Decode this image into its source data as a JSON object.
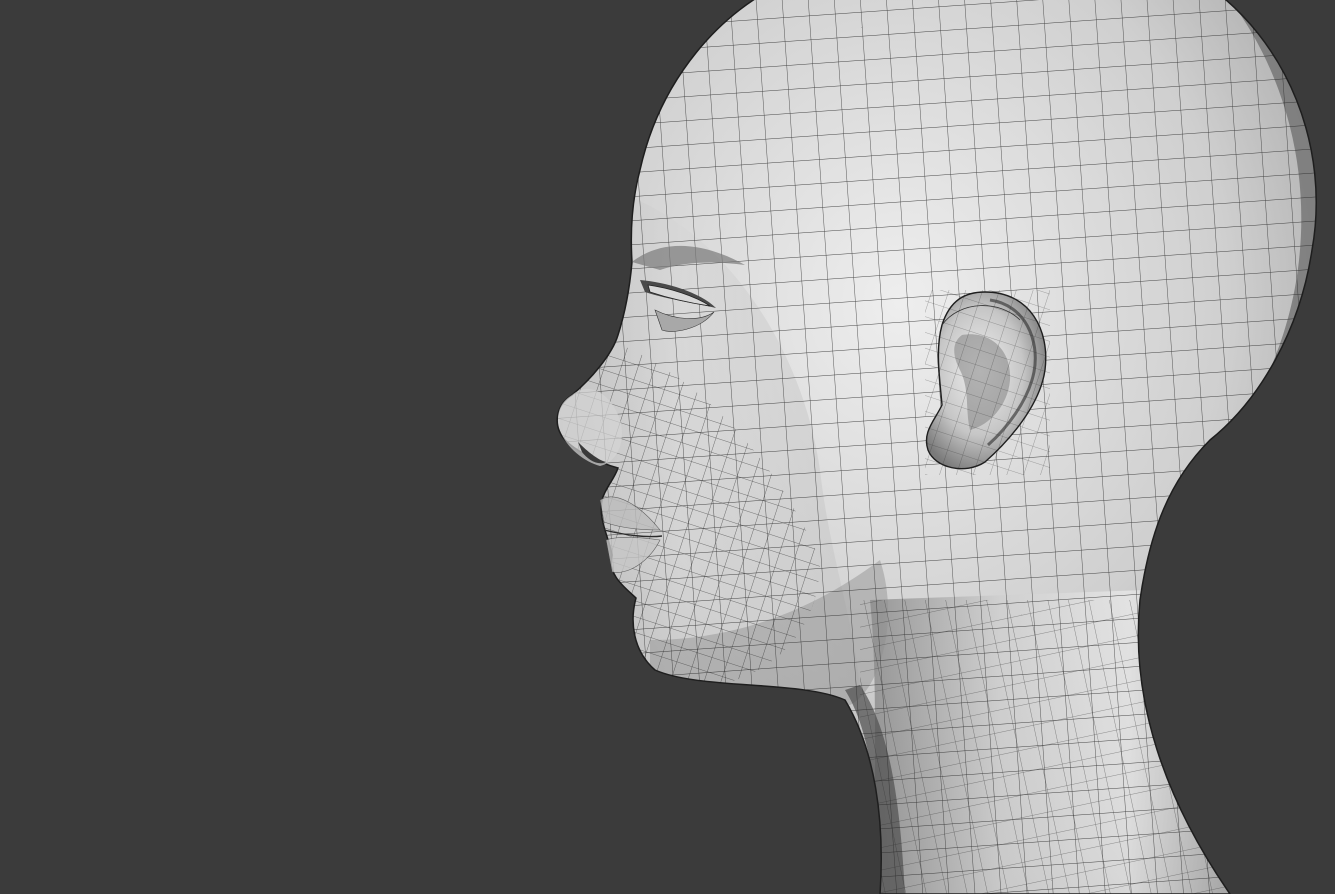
{
  "scene": {
    "subject": "head-mesh",
    "background_color": "#3b3b3b",
    "mesh_base_color": "#c9c9c9",
    "mesh_highlight_color": "#eeeeee",
    "mesh_shadow_color": "#6f6f6f",
    "wire_color": "#2a2a2a"
  }
}
